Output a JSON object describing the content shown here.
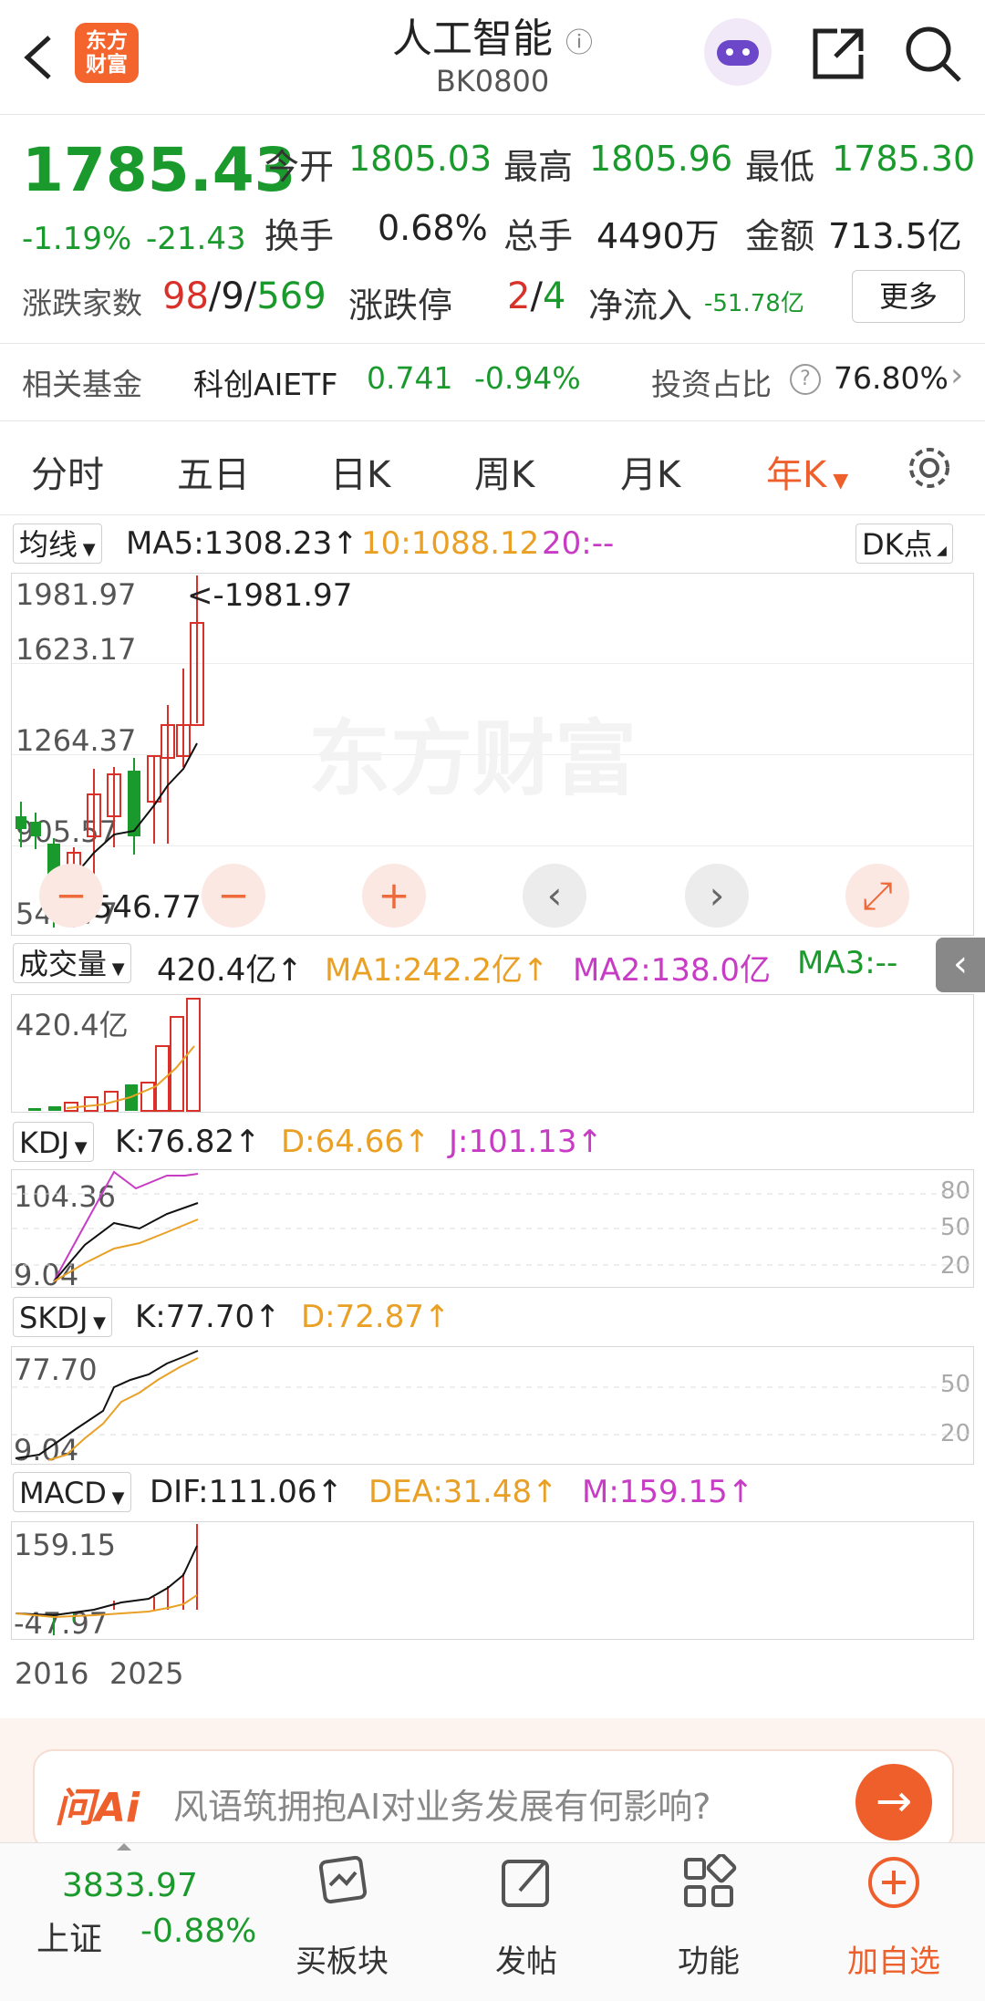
{
  "header": {
    "title": "人工智能",
    "info_icon": "ⓘ",
    "code": "BK0800",
    "logo_line1": "东方",
    "logo_line2": "财富"
  },
  "quote": {
    "price": "1785.43",
    "change_pct": "-1.19%",
    "change": "-21.43",
    "open_label": "今开",
    "open": "1805.03",
    "high_label": "最高",
    "high": "1805.96",
    "low_label": "最低",
    "low": "1785.30",
    "turnover_label": "换手",
    "turnover": "0.68%",
    "volume_label": "总手",
    "volume": "4490万",
    "amount_label": "金额",
    "amount": "713.5亿",
    "updown_label": "涨跌家数",
    "up": "98",
    "flat": "9",
    "down": "569",
    "limit_label": "涨跌停",
    "limit_up": "2",
    "limit_down": "4",
    "inflow_label": "净流入",
    "inflow": "-51.78亿",
    "more_label": "更多"
  },
  "fund": {
    "label": "相关基金",
    "name": "科创AIETF",
    "price": "0.741",
    "pct": "-0.94%",
    "ratio_label": "投资占比",
    "ratio": "76.80%"
  },
  "tabs": [
    "分时",
    "五日",
    "日K",
    "周K",
    "月K",
    "年K"
  ],
  "ma_bar": {
    "select": "均线",
    "ma5": "MA5:1308.23↑",
    "ma10": "10:1088.12",
    "ma20": "20:--",
    "dk": "DK点"
  },
  "kline": {
    "ticks": [
      "1981.97",
      "1623.17",
      "1264.37",
      "905.57",
      "546.77"
    ],
    "max_marker": "<-1981.97",
    "min_marker": "<-546.77",
    "watermark": "东方财富"
  },
  "volume_bar": {
    "select": "成交量",
    "v": "420.4亿↑",
    "ma1": "MA1:242.2亿↑",
    "ma2": "MA2:138.0亿",
    "ma3": "MA3:--",
    "axis": "420.4亿"
  },
  "kdj": {
    "select": "KDJ",
    "k": "K:76.82↑",
    "d": "D:64.66↑",
    "j": "J:101.13↑",
    "axis_top": "104.36",
    "axis_bottom": "9.04",
    "levels": [
      "80",
      "50",
      "20"
    ]
  },
  "skdj": {
    "select": "SKDJ",
    "k": "K:77.70↑",
    "d": "D:72.87↑",
    "axis_top": "77.70",
    "axis_bottom": "9.04",
    "levels": [
      "50",
      "20"
    ]
  },
  "macd": {
    "select": "MACD",
    "dif": "DIF:111.06↑",
    "dea": "DEA:31.48↑",
    "m": "M:159.15↑",
    "axis_top": "159.15",
    "axis_bottom": "-47.97"
  },
  "years": [
    "2016",
    "2025"
  ],
  "ai": {
    "brand": "问Ai",
    "text": "风语筑拥抱AI对业务发展有何影响?"
  },
  "bottom": {
    "index_value": "3833.97",
    "index_name": "上证",
    "index_pct": "-0.88%",
    "items": [
      "买板块",
      "发帖",
      "功能",
      "加自选"
    ]
  },
  "colors": {
    "green": "#1a9a2c",
    "red": "#d9312a",
    "orange": "#e9a025",
    "purple": "#c83cc5",
    "accent": "#ef5f2b"
  }
}
